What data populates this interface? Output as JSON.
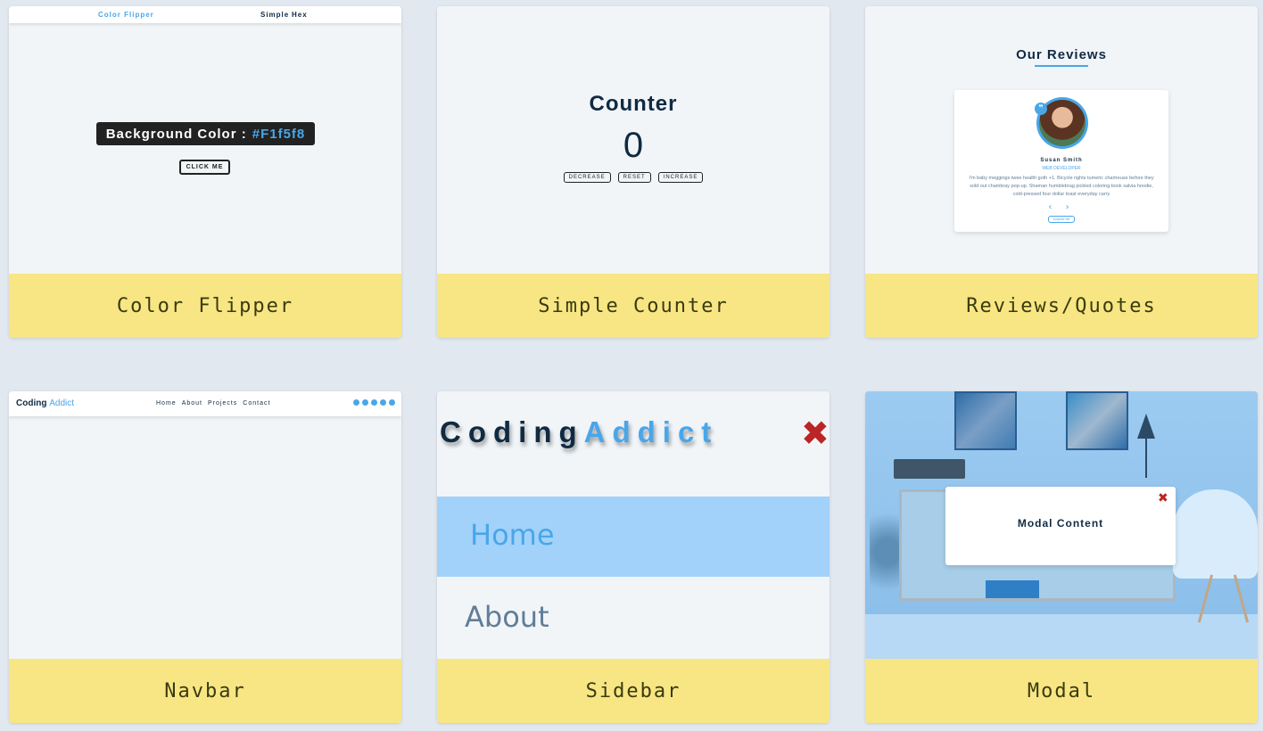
{
  "projects": [
    {
      "footer_label": "Color Flipper",
      "preview": {
        "nav_logo": "Color Flipper",
        "nav_links": [
          "Simple",
          "Hex"
        ],
        "banner_label": "Background Color :",
        "banner_value": "#F1f5f8",
        "button_label": "CLICK ME"
      }
    },
    {
      "footer_label": "Simple Counter",
      "preview": {
        "title": "Counter",
        "value": "0",
        "buttons": [
          "DECREASE",
          "RESET",
          "INCREASE"
        ]
      }
    },
    {
      "footer_label": "Reviews/Quotes",
      "preview": {
        "title": "Our Reviews",
        "name": "Susan Smith",
        "job": "WEB DEVELOPER",
        "text": "I'm baby meggings twee health goth +1. Bicycle rights tumeric chartreuse before they sold out chambray pop-up. Shaman humblebrag pickled coloring book salvia hoodie, cold-pressed four dollar toast everyday carry",
        "arrows": "‹ ›",
        "surprise_label": "Surprise Me"
      }
    },
    {
      "footer_label": "Navbar",
      "preview": {
        "logo_main": "Coding",
        "logo_accent": "Addict",
        "links": [
          "Home",
          "About",
          "Projects",
          "Contact"
        ],
        "social_icons": [
          "facebook-icon",
          "twitter-icon",
          "behance-icon",
          "linkedin-icon",
          "sketch-icon"
        ]
      }
    },
    {
      "footer_label": "Sidebar",
      "preview": {
        "logo_main": "Coding",
        "logo_accent": "Addict",
        "close_glyph": "✖",
        "items": [
          "Home",
          "About"
        ]
      }
    },
    {
      "footer_label": "Modal",
      "preview": {
        "modal_text": "Modal Content",
        "close_glyph": "✖"
      }
    }
  ],
  "colors": {
    "page_background": "#e2e8f0",
    "card_background": "#f1f5f8",
    "footer_background": "#f7e683",
    "accent": "#49a6e9",
    "close_red": "#bb2525",
    "dark_text": "#102a42"
  }
}
